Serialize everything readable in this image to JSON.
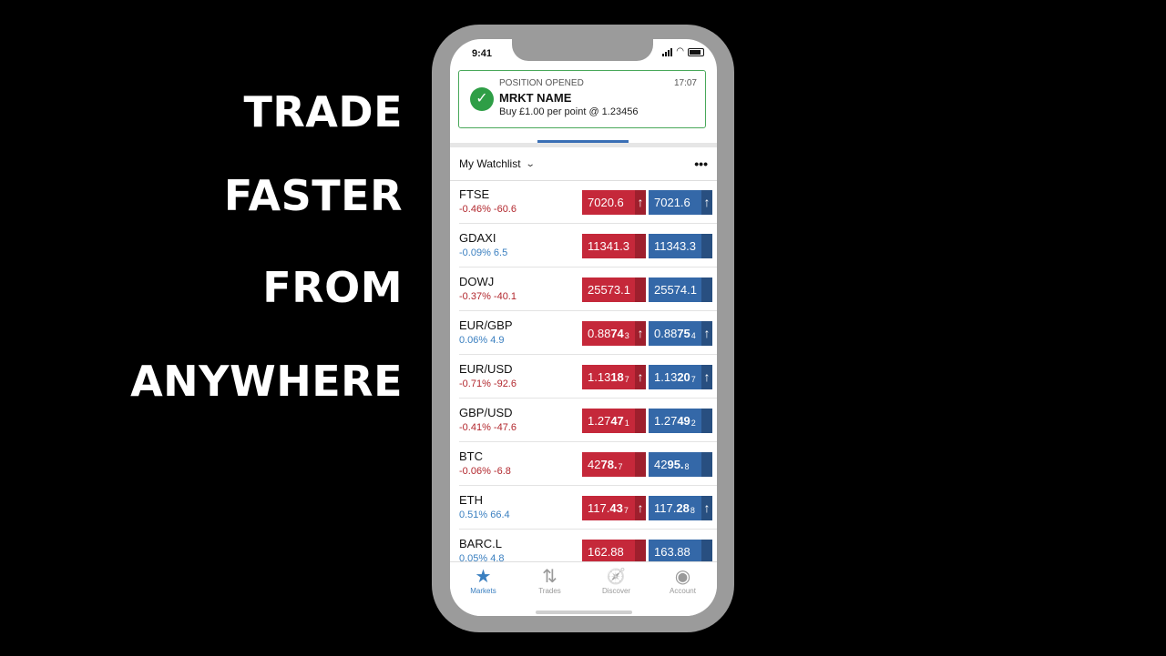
{
  "slogan": [
    "TRADE",
    "FASTER",
    "FROM",
    "ANYWHERE"
  ],
  "status_bar": {
    "time": "9:41"
  },
  "notification": {
    "label": "POSITION OPENED",
    "time": "17:07",
    "title": "MRKT NAME",
    "detail": "Buy £1.00 per point @ 1.23456",
    "icon": "checkmark-icon"
  },
  "watchlist": {
    "title": "My Watchlist",
    "more_icon": "•••",
    "rows": [
      {
        "name": "FTSE",
        "change": "-0.46% -60.6",
        "dir": "neg",
        "sell": "7020.6",
        "buy": "7021.6",
        "arrow": true
      },
      {
        "name": "GDAXI",
        "change": "-0.09% 6.5",
        "dir": "pos",
        "sell": "11341.3",
        "buy": "11343.3",
        "arrow": false
      },
      {
        "name": "DOWJ",
        "change": "-0.37% -40.1",
        "dir": "neg",
        "sell": "25573.1",
        "buy": "25574.1",
        "arrow": false
      },
      {
        "name": "EUR/GBP",
        "change": "0.06% 4.9",
        "dir": "pos",
        "sell_pre": "0.88",
        "sell_big": "74",
        "sell_sub": "3",
        "buy_pre": "0.88",
        "buy_big": "75",
        "buy_sub": "4",
        "arrow": true
      },
      {
        "name": "EUR/USD",
        "change": "-0.71% -92.6",
        "dir": "neg",
        "sell_pre": "1.13",
        "sell_big": "18",
        "sell_sub": "7",
        "buy_pre": "1.13",
        "buy_big": "20",
        "buy_sub": "7",
        "arrow": true
      },
      {
        "name": "GBP/USD",
        "change": "-0.41% -47.6",
        "dir": "neg",
        "sell_pre": "1.27",
        "sell_big": "47",
        "sell_sub": "1",
        "buy_pre": "1.27",
        "buy_big": "49",
        "buy_sub": "2",
        "arrow": false
      },
      {
        "name": "BTC",
        "change": "-0.06% -6.8",
        "dir": "neg",
        "sell_pre": "42",
        "sell_big": "78.",
        "sell_sub": "7",
        "buy_pre": "42",
        "buy_big": "95.",
        "buy_sub": "8",
        "arrow": false
      },
      {
        "name": "ETH",
        "change": "0.51% 66.4",
        "dir": "pos",
        "sell_pre": "117.",
        "sell_big": "43",
        "sell_sub": "7",
        "buy_pre": "117.",
        "buy_big": "28",
        "buy_sub": "8",
        "arrow": true
      },
      {
        "name": "BARC.L",
        "change": "0.05% 4.8",
        "dir": "pos",
        "sell": "162.88",
        "buy": "163.88",
        "arrow": false
      }
    ]
  },
  "nav": [
    {
      "label": "Markets",
      "icon": "star-icon",
      "glyph": "★",
      "active": true
    },
    {
      "label": "Trades",
      "icon": "swap-arrows-icon",
      "glyph": "⇅",
      "active": false
    },
    {
      "label": "Discover",
      "icon": "compass-icon",
      "glyph": "🧭",
      "active": false
    },
    {
      "label": "Account",
      "icon": "user-circle-icon",
      "glyph": "◉",
      "active": false
    }
  ],
  "colors": {
    "sell": "#c5283a",
    "buy": "#3468a8",
    "accent": "#3a7fc0",
    "success": "#2e9e46"
  }
}
